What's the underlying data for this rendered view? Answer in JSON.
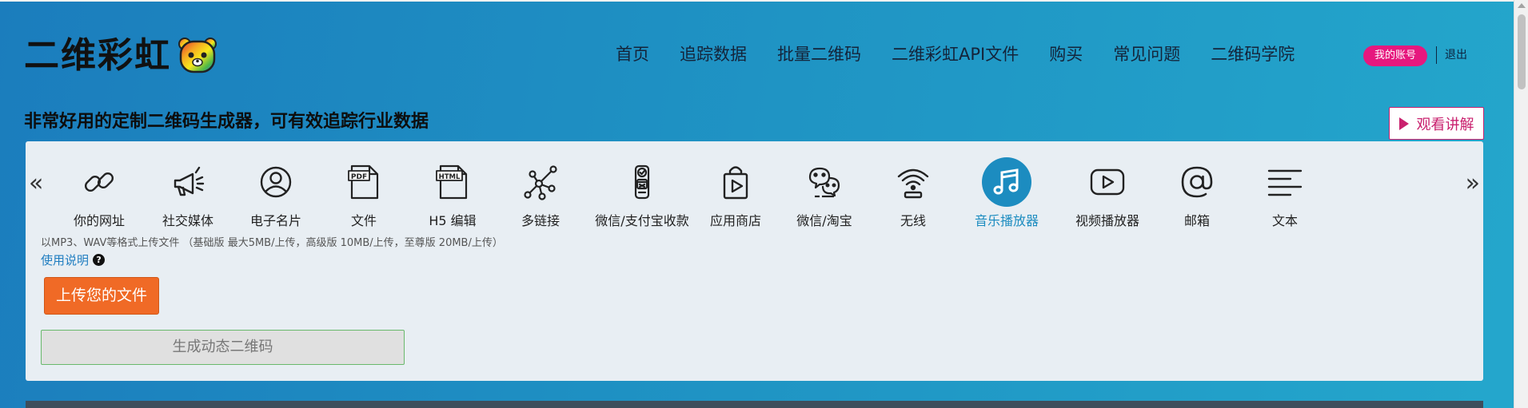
{
  "header": {
    "logo_text": "二维彩虹",
    "nav": [
      "首页",
      "追踪数据",
      "批量二维码",
      "二维彩虹API文件",
      "购买",
      "常见问题",
      "二维码学院"
    ],
    "account_label": "我的账号",
    "logout_label": "退出"
  },
  "hero": {
    "tagline": "非常好用的定制二维码生成器，可有效追踪行业数据",
    "watch_label": "观看讲解"
  },
  "tools": {
    "prev_arrow": "«",
    "next_arrow": "»",
    "items": [
      {
        "label": "你的网址",
        "icon": "link-icon"
      },
      {
        "label": "社交媒体",
        "icon": "megaphone-icon"
      },
      {
        "label": "电子名片",
        "icon": "user-circle-icon"
      },
      {
        "label": "文件",
        "icon": "pdf-file-icon"
      },
      {
        "label": "H5 编辑",
        "icon": "html-file-icon"
      },
      {
        "label": "多链接",
        "icon": "network-icon"
      },
      {
        "label": "微信/支付宝收款",
        "icon": "payment-icon"
      },
      {
        "label": "应用商店",
        "icon": "shopping-bag-icon"
      },
      {
        "label": "微信/淘宝",
        "icon": "wechat-icon"
      },
      {
        "label": "无线",
        "icon": "wifi-icon"
      },
      {
        "label": "音乐播放器",
        "icon": "music-icon",
        "active": true
      },
      {
        "label": "视频播放器",
        "icon": "play-icon"
      },
      {
        "label": "邮箱",
        "icon": "at-icon"
      },
      {
        "label": "文本",
        "icon": "text-lines-icon"
      }
    ],
    "icon_labels": {
      "pdf": "PDF",
      "html": "HTML"
    }
  },
  "form": {
    "hint": "以MP3、WAV等格式上传文件 （基础版 最大5MB/上传，高级版 10MB/上传，至尊版 20MB/上传）",
    "usage_label": "使用说明",
    "help_glyph": "?",
    "upload_label": "上传您的文件",
    "generate_label": "生成动态二维码"
  },
  "colors": {
    "accent": "#1c8cc0",
    "account": "#e6187e",
    "upload": "#f06a26",
    "watch": "#c9216e"
  }
}
